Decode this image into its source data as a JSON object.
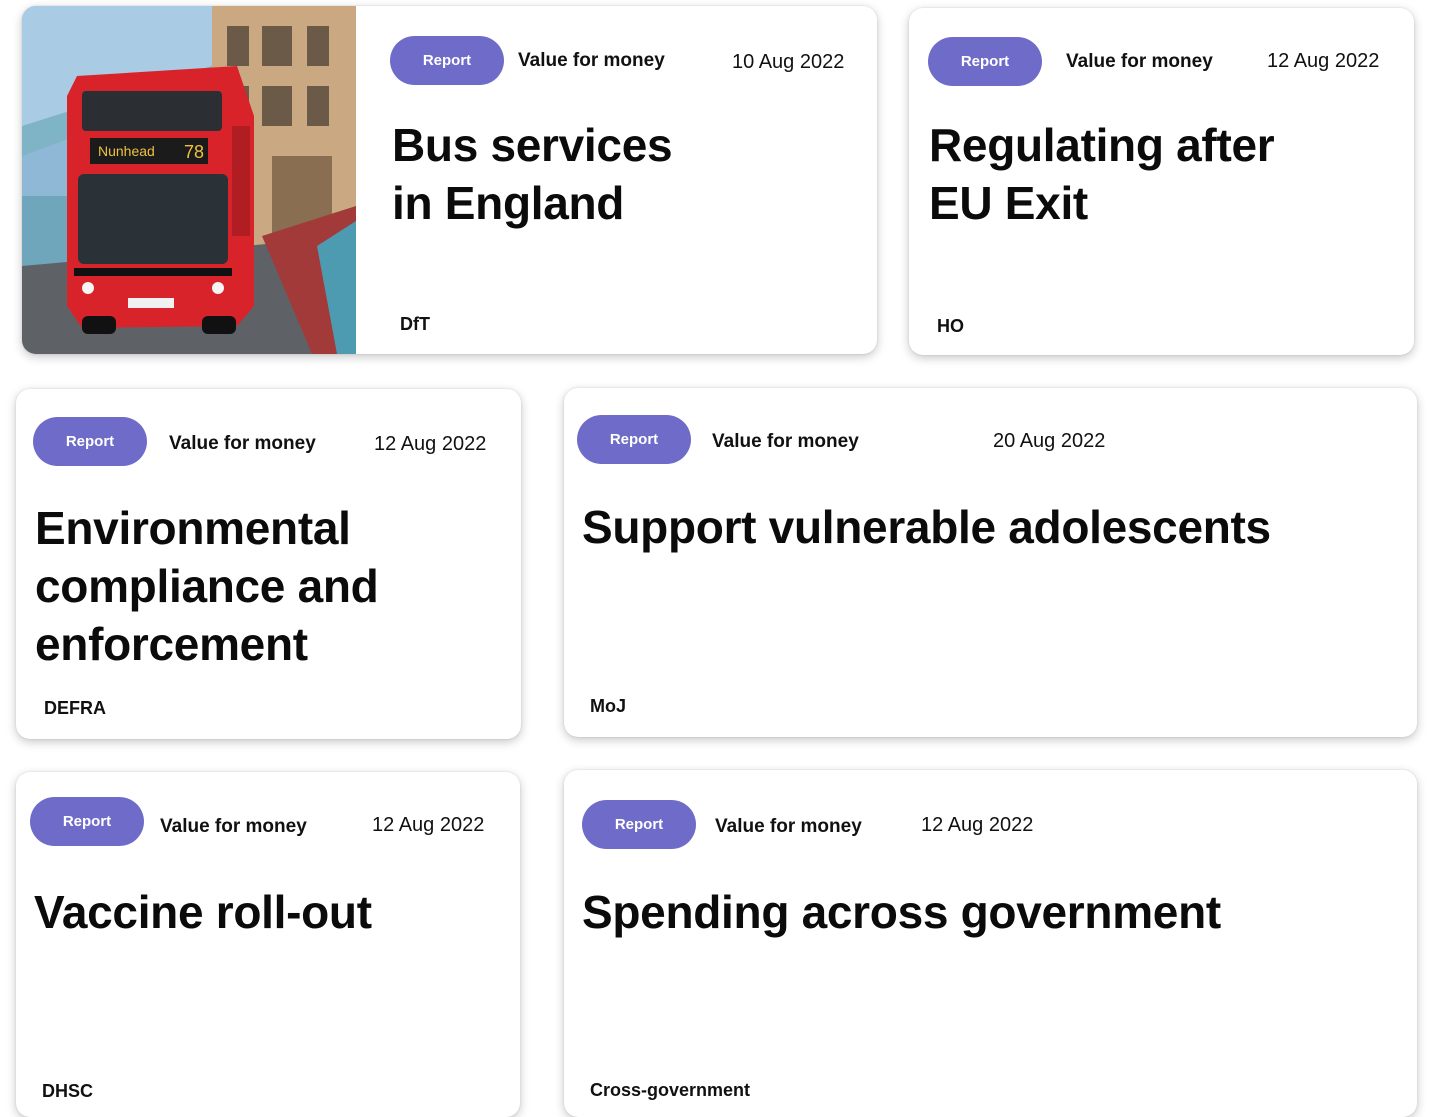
{
  "cards": [
    {
      "badge": "Report",
      "category": "Value for money",
      "date": "10 Aug 2022",
      "title_lines": [
        "Bus services",
        "in England"
      ],
      "department": "DfT",
      "image_subject": "red double-decker bus on Tower Bridge",
      "bus_destination": "Nunhead",
      "bus_route": "78"
    },
    {
      "badge": "Report",
      "category": "Value for money",
      "date": "12 Aug 2022",
      "title_lines": [
        "Regulating after",
        "EU Exit"
      ],
      "department": "HO"
    },
    {
      "badge": "Report",
      "category": "Value for money",
      "date": "12 Aug 2022",
      "title_lines": [
        "Environmental",
        "compliance and",
        "enforcement"
      ],
      "department": "DEFRA"
    },
    {
      "badge": "Report",
      "category": "Value for money",
      "date": "20 Aug 2022",
      "title_lines": [
        "Support vulnerable adolescents"
      ],
      "department": "MoJ"
    },
    {
      "badge": "Report",
      "category": "Value for money",
      "date": "12 Aug 2022",
      "title_lines": [
        "Vaccine roll-out"
      ],
      "department": "DHSC"
    },
    {
      "badge": "Report",
      "category": "Value for money",
      "date": "12 Aug 2022",
      "title_lines": [
        "Spending across government"
      ],
      "department": "Cross-government"
    }
  ],
  "colors": {
    "badge": "#6e6cc8",
    "bus_red": "#d8232a"
  }
}
